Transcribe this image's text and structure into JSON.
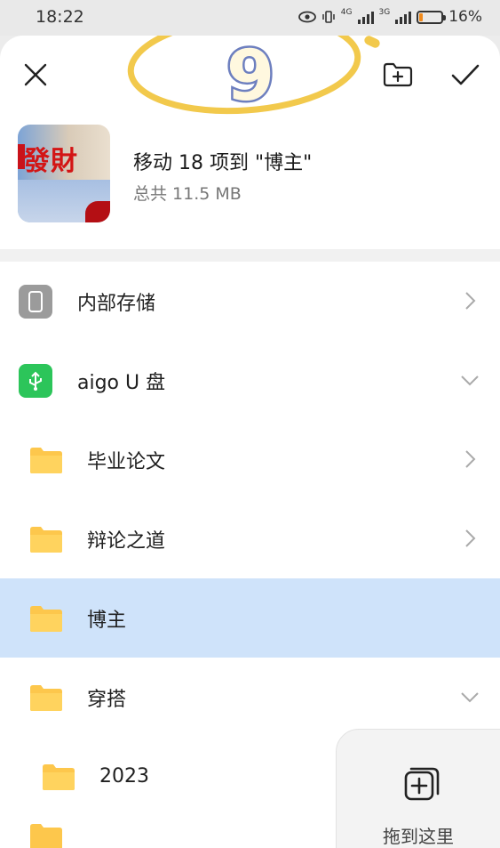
{
  "status_bar": {
    "time": "18:22",
    "battery_percent": "16%",
    "battery_level": 0.16,
    "net_label_1": "4G",
    "net_label_2": "3G"
  },
  "toolbar": {
    "close_icon": "close-icon",
    "new_folder_icon": "new-folder-icon",
    "confirm_icon": "check-icon"
  },
  "sticker": {
    "number": "9"
  },
  "summary": {
    "title": "移动 18 项到 \"博主\"",
    "size": "总共 11.5 MB",
    "thumb_text": "發財"
  },
  "list": {
    "items": [
      {
        "label": "内部存储",
        "icon": "phone-storage-icon",
        "chevron": "right"
      },
      {
        "label": "aigo U 盘",
        "icon": "usb-icon",
        "chevron": "down"
      },
      {
        "label": "毕业论文",
        "icon": "folder-icon",
        "chevron": "right"
      },
      {
        "label": "辩论之道",
        "icon": "folder-icon",
        "chevron": "right"
      },
      {
        "label": "博主",
        "icon": "folder-icon",
        "chevron": "",
        "selected": true
      },
      {
        "label": "穿搭",
        "icon": "folder-icon",
        "chevron": "down"
      },
      {
        "label": "2023",
        "icon": "folder-icon",
        "chevron": ""
      }
    ]
  },
  "drop_target": {
    "label": "拖到这里"
  },
  "colors": {
    "selected_row": "#cfe3fa",
    "folder": "#fdc74c",
    "usb_badge": "#2cc55a",
    "battery_low": "#f08a1c",
    "sticker_ring": "#f2c94c",
    "sticker_number": "#6d7fbf"
  }
}
